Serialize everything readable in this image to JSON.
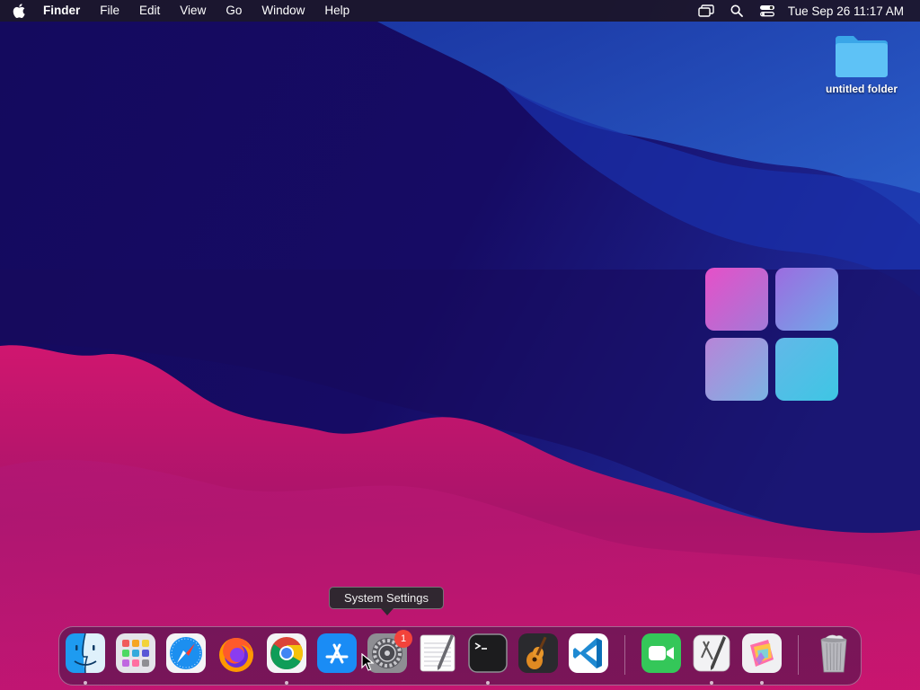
{
  "menubar": {
    "app_name": "Finder",
    "menus": [
      "File",
      "Edit",
      "View",
      "Go",
      "Window",
      "Help"
    ],
    "clock": "Tue Sep 26  11:17 AM"
  },
  "desktop": {
    "folder_label": "untitled folder"
  },
  "tooltip": "System Settings",
  "dock": {
    "apps": [
      {
        "name": "Finder",
        "icon": "finder-icon",
        "running": true
      },
      {
        "name": "Launchpad",
        "icon": "launchpad-icon",
        "running": false
      },
      {
        "name": "Safari",
        "icon": "safari-icon",
        "running": false
      },
      {
        "name": "Firefox",
        "icon": "firefox-icon",
        "running": false
      },
      {
        "name": "Google Chrome",
        "icon": "chrome-icon",
        "running": true
      },
      {
        "name": "App Store",
        "icon": "app-store-icon",
        "running": false
      },
      {
        "name": "System Settings",
        "icon": "system-settings-icon",
        "running": false,
        "badge": "1"
      },
      {
        "name": "TextEdit",
        "icon": "textedit-icon",
        "running": false
      },
      {
        "name": "Terminal",
        "icon": "terminal-icon",
        "running": true
      },
      {
        "name": "GarageBand",
        "icon": "garageband-icon",
        "running": false
      },
      {
        "name": "Visual Studio Code",
        "icon": "vscode-icon",
        "running": false
      },
      {
        "name": "FaceTime",
        "icon": "facetime-icon",
        "running": false
      },
      {
        "name": "Script Editor",
        "icon": "script-editor-icon",
        "running": true
      },
      {
        "name": "Pixelmator",
        "icon": "pixelmator-icon",
        "running": true
      },
      {
        "name": "Trash",
        "icon": "trash-icon",
        "running": false
      }
    ]
  },
  "colors": {
    "wallpaper_navy": "#120a5c",
    "wallpaper_blue": "#2a5cc8",
    "wallpaper_magenta": "#c8166e",
    "badge_red": "#f2433b"
  }
}
